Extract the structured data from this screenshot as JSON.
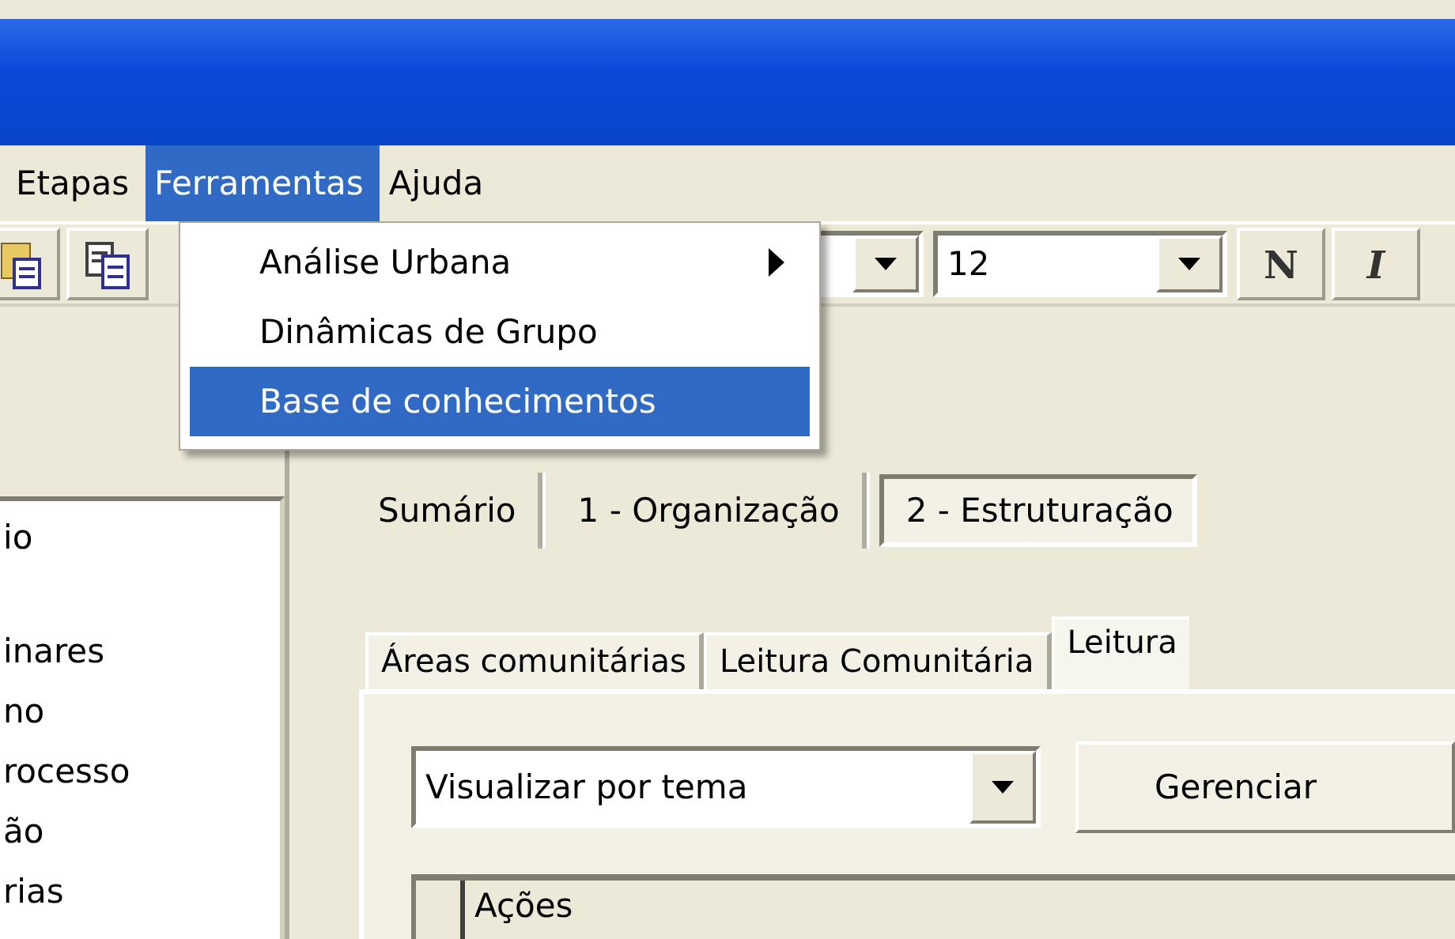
{
  "menu_bar": [
    {
      "label": "Etapas",
      "selected": false
    },
    {
      "label": "Ferramentas",
      "selected": true
    },
    {
      "label": "Ajuda",
      "selected": false
    }
  ],
  "dropdown": {
    "items": [
      {
        "label": "Análise Urbana",
        "submenu": true,
        "selected": false
      },
      {
        "label": "Dinâmicas de Grupo",
        "submenu": false,
        "selected": false
      },
      {
        "label": "Base de conhecimentos",
        "submenu": false,
        "selected": true
      }
    ]
  },
  "toolbar": {
    "font_size": "12",
    "bold_label": "N",
    "italic_label": "I"
  },
  "left_list": {
    "items": [
      "io",
      "inares",
      "no",
      "rocesso",
      "ão",
      "rias"
    ]
  },
  "step_tabs": [
    {
      "label": "Sumário",
      "selected": false
    },
    {
      "label": "1 - Organização",
      "selected": false
    },
    {
      "label": "2 - Estruturação",
      "selected": true
    }
  ],
  "inner_tabs": [
    {
      "label": "Áreas comunitárias",
      "selected": false
    },
    {
      "label": "Leitura Comunitária",
      "selected": false
    },
    {
      "label": "Leitura",
      "selected": true
    }
  ],
  "view_select": {
    "value": "Visualizar por tema"
  },
  "manage_button": "Gerenciar",
  "table": {
    "columns": [
      "Ações"
    ]
  }
}
